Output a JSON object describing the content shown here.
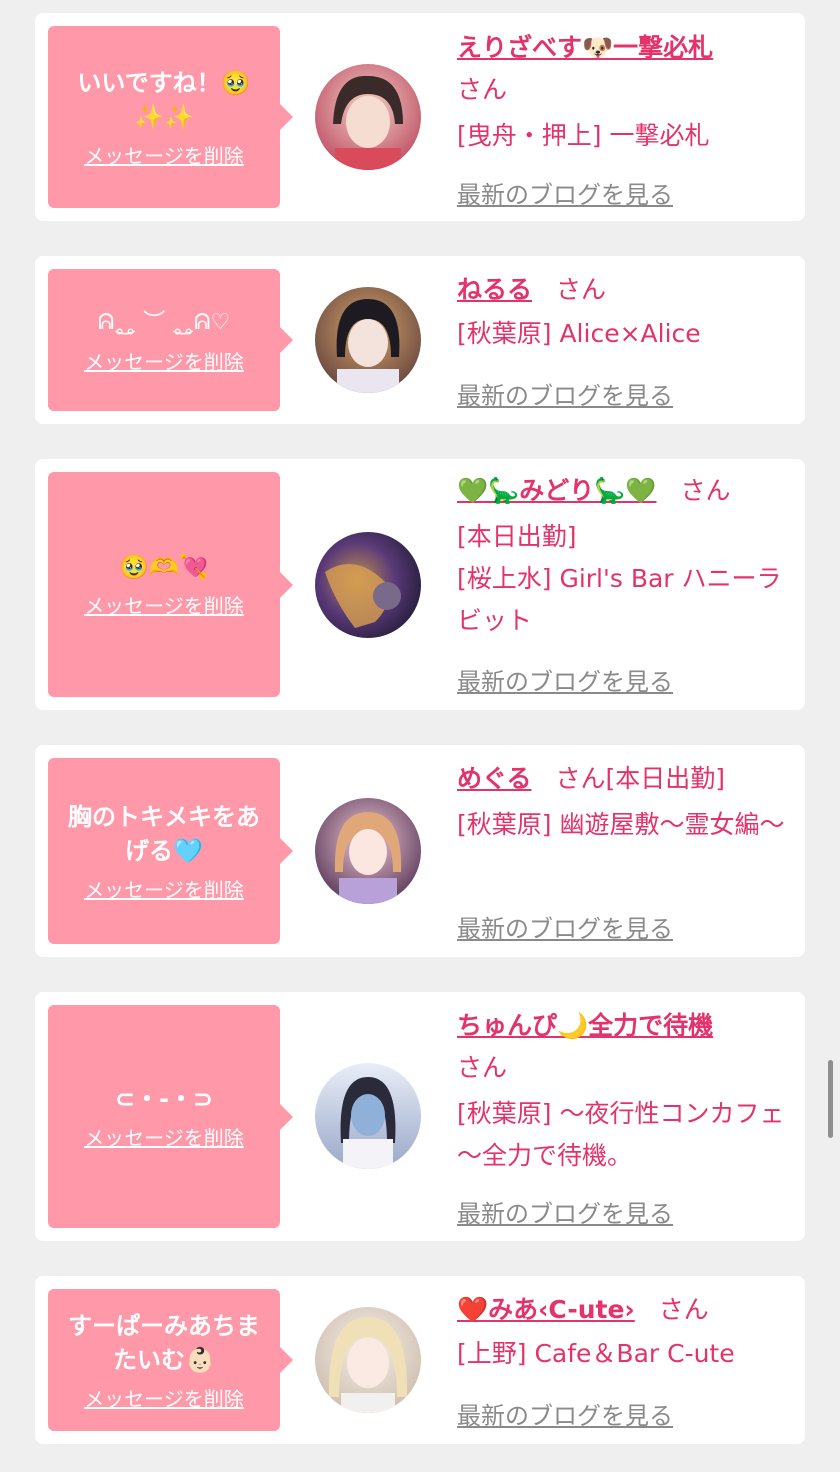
{
  "delete_label": "メッセージを削除",
  "blog_label": "最新のブログを見る",
  "san_label": "さん",
  "accent_color": "#e3336a",
  "bubble_color": "#ff98a8",
  "items": [
    {
      "message": "いいですね！🥹\n✨✨",
      "name": "えりざべす🐶一撃必札",
      "shop_lines": [
        "[曳舟・押上] 一撃必札"
      ]
    },
    {
      "message": "ᕱ˳͜˳ ︶ ˳͜˳ᕱ♡",
      "name": "ねるる",
      "shop_lines": [
        "[秋葉原] Alice×Alice"
      ]
    },
    {
      "message": "🥹🫶💘",
      "name": "💚🦕みどり🦕💚",
      "shop_lines": [
        "[本日出勤]",
        "[桜上水] Girl's Bar ハニーラビット"
      ]
    },
    {
      "message": "胸のトキメキをあげる🩵",
      "name": "めぐる",
      "shop_lines": [
        "[本日出勤]",
        "[秋葉原] 幽遊屋敷～霊女編～"
      ]
    },
    {
      "message": "⊂・-・⊃",
      "name": "ちゅんぴ🌙全力で待機",
      "shop_lines": [
        "[秋葉原] ～夜行性コンカフェ～全力で待機。"
      ]
    },
    {
      "message": "すーぱーみあちまたいむ👶🏻",
      "name": "❤️みあ‹C-ute›",
      "shop_lines": [
        "[上野] Cafe＆Bar C-ute"
      ]
    }
  ]
}
